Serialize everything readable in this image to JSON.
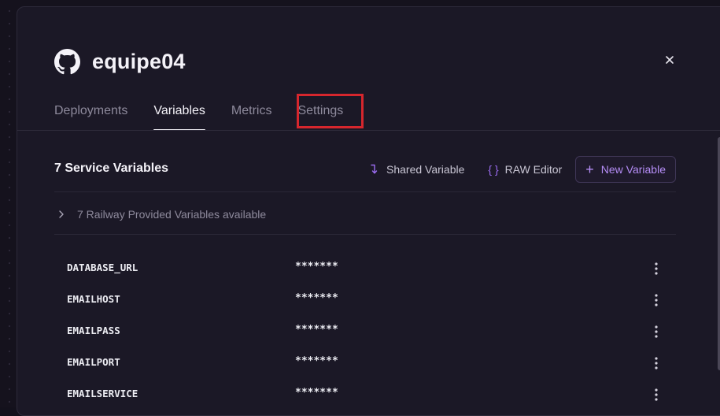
{
  "service": {
    "name": "equipe04",
    "icon": "github-icon"
  },
  "tabs": [
    {
      "label": "Deployments",
      "active": false
    },
    {
      "label": "Variables",
      "active": true
    },
    {
      "label": "Metrics",
      "active": false
    },
    {
      "label": "Settings",
      "active": false,
      "highlighted": true
    }
  ],
  "variables_section": {
    "title": "7 Service Variables",
    "actions": {
      "shared_variable": "Shared Variable",
      "raw_editor": "RAW Editor",
      "new_variable": "New Variable"
    },
    "provided_toggle": "7 Railway Provided Variables available",
    "rows": [
      {
        "name": "DATABASE_URL",
        "value": "*******"
      },
      {
        "name": "EMAILHOST",
        "value": "*******"
      },
      {
        "name": "EMAILPASS",
        "value": "*******"
      },
      {
        "name": "EMAILPORT",
        "value": "*******"
      },
      {
        "name": "EMAILSERVICE",
        "value": "*******"
      }
    ]
  },
  "colors": {
    "accent": "#9b6cf0",
    "highlight_box": "#d6262d",
    "panel_bg": "#1b1826"
  }
}
